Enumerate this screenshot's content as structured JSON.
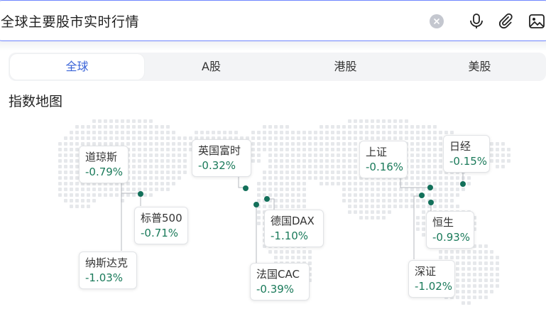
{
  "search": {
    "query": "全球主要股市实时行情"
  },
  "tabs": [
    {
      "label": "全球",
      "active": true
    },
    {
      "label": "A股",
      "active": false
    },
    {
      "label": "港股",
      "active": false
    },
    {
      "label": "美股",
      "active": false
    }
  ],
  "section": {
    "title": "指数地图"
  },
  "colors": {
    "accent": "#3a64d8",
    "down": "#1a7a5a",
    "dot": "#13705a",
    "border": "#6e86ff"
  },
  "indices": [
    {
      "name": "道琼斯",
      "change": "-0.79%"
    },
    {
      "name": "标普500",
      "change": "-0.71%"
    },
    {
      "name": "纳斯达克",
      "change": "-1.03%"
    },
    {
      "name": "英国富时",
      "change": "-0.32%"
    },
    {
      "name": "德国DAX",
      "change": "-1.10%"
    },
    {
      "name": "法国CAC",
      "change": "-0.39%"
    },
    {
      "name": "上证",
      "change": "-0.16%"
    },
    {
      "name": "日经",
      "change": "-0.15%"
    },
    {
      "name": "恒生",
      "change": "-0.93%"
    },
    {
      "name": "深证",
      "change": "-1.02%"
    }
  ]
}
